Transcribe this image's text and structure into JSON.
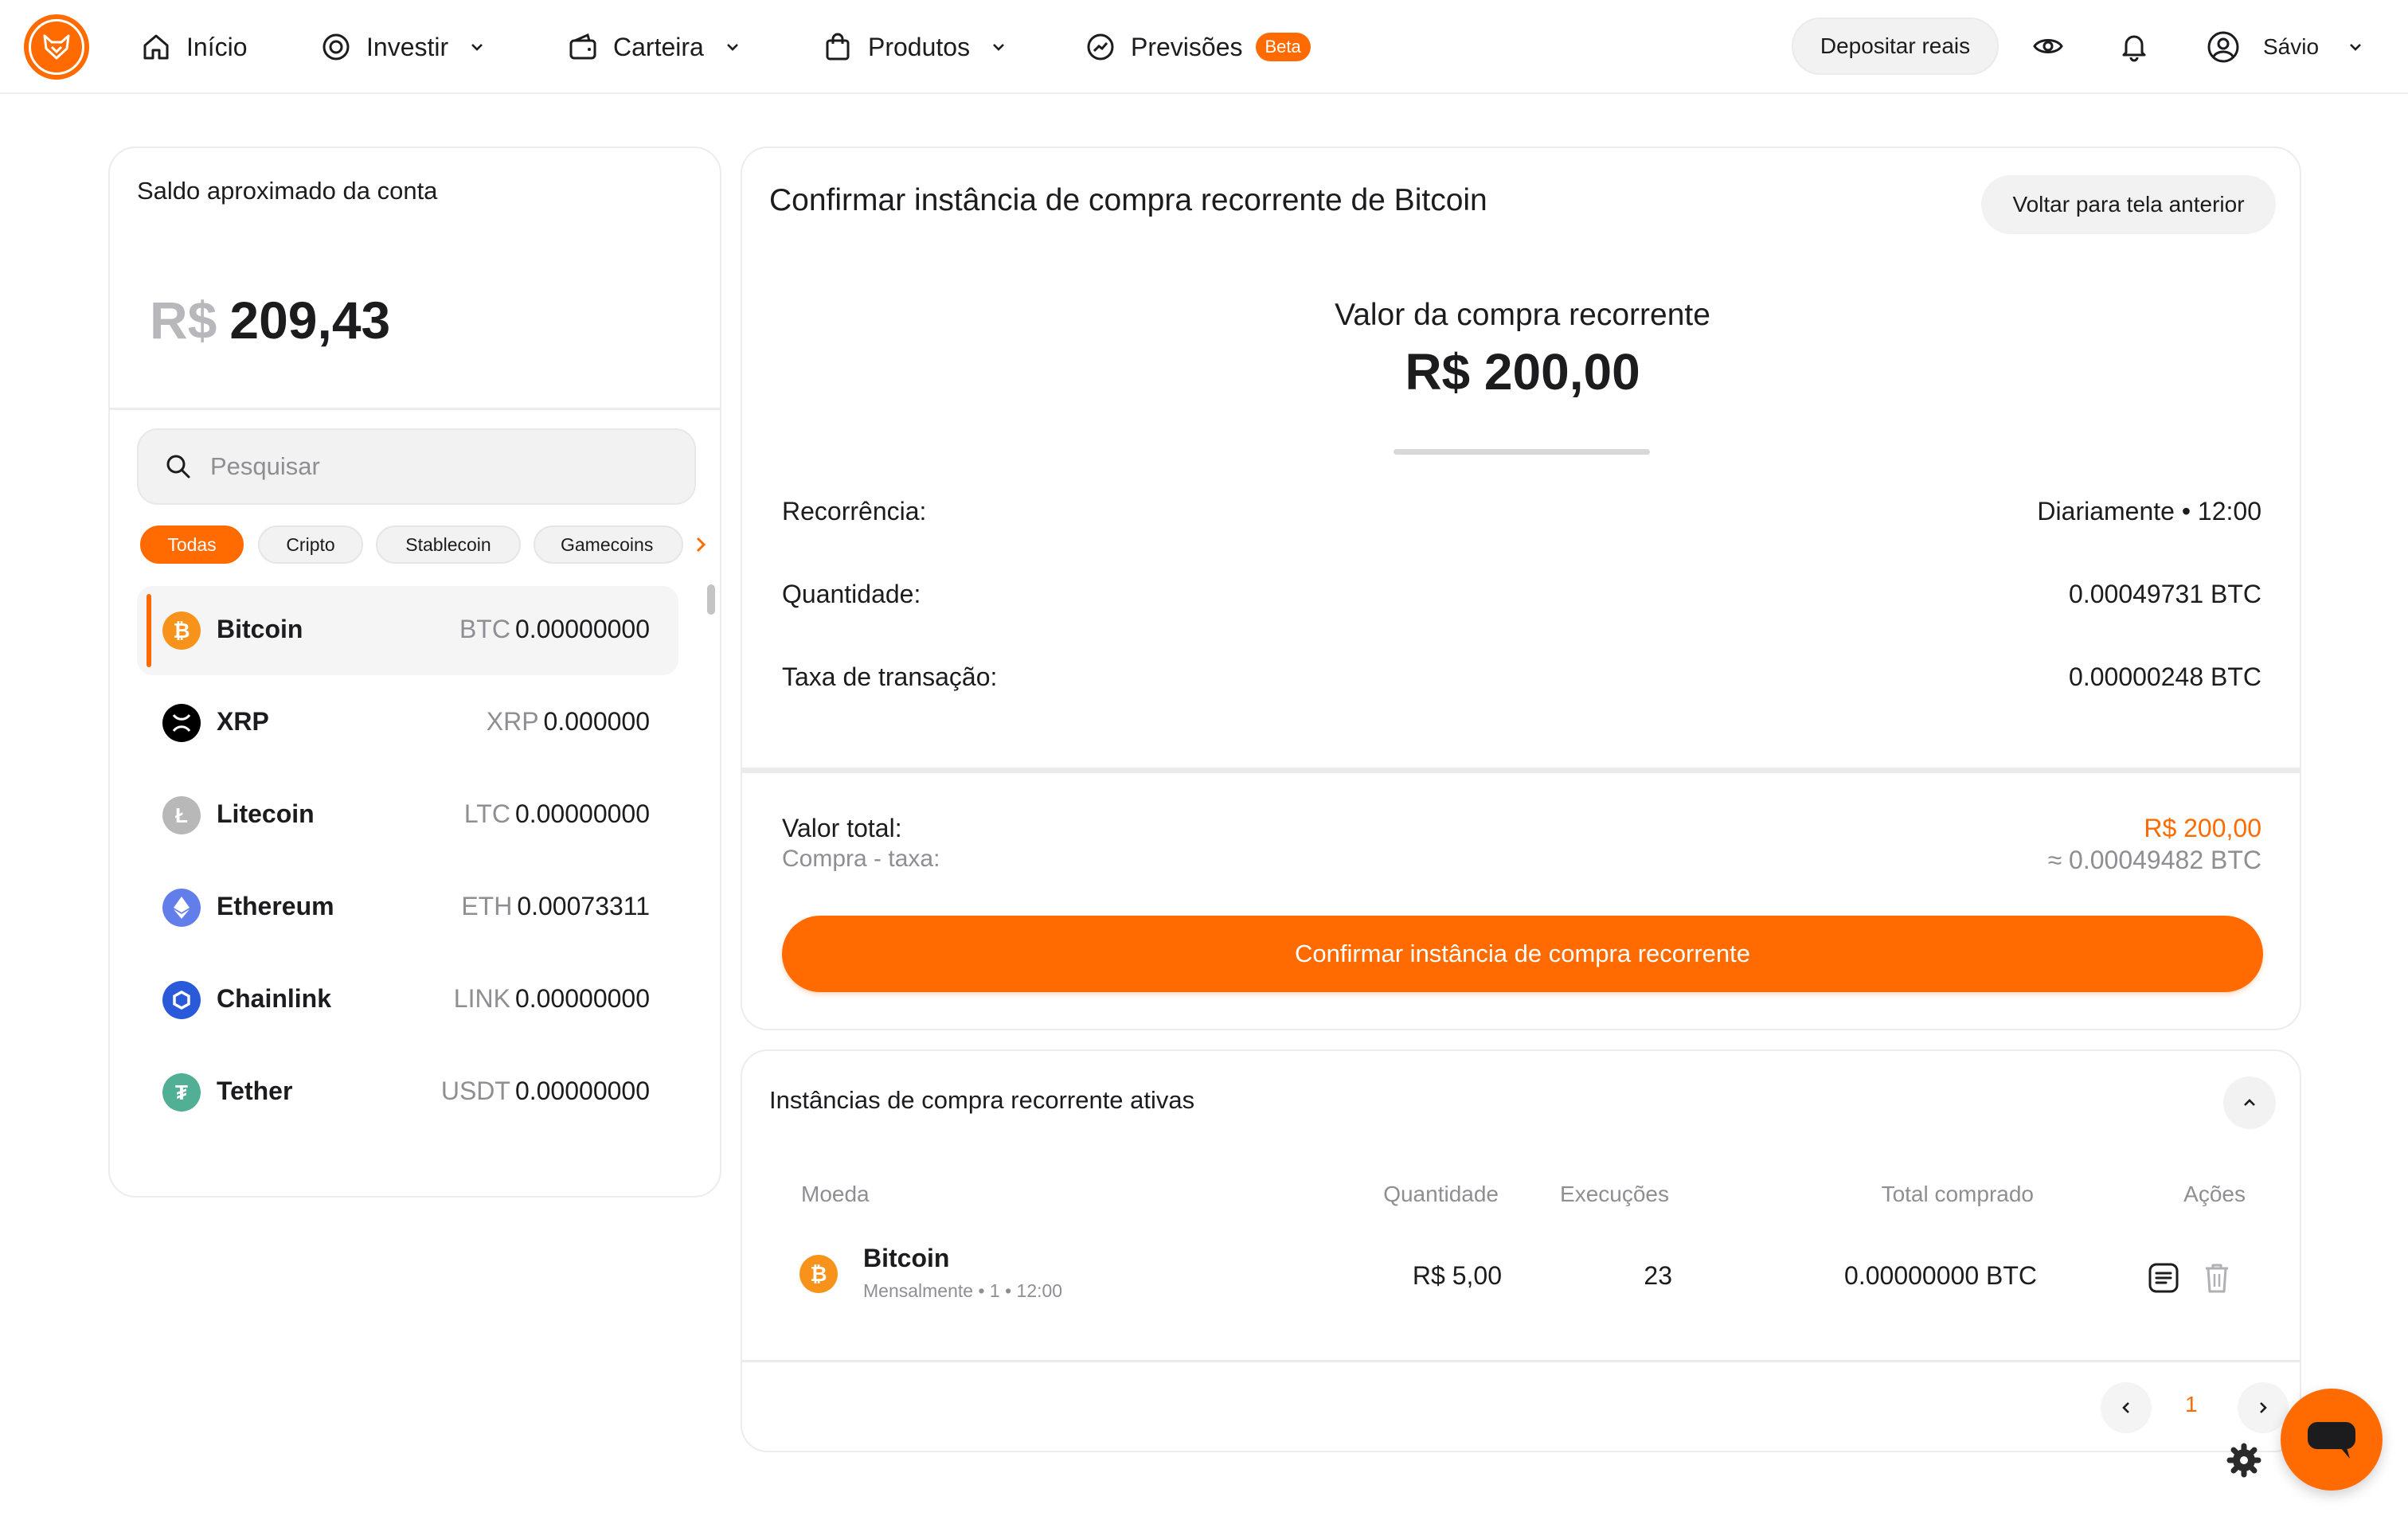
{
  "nav": {
    "items": [
      {
        "label": "Início",
        "icon": "home-icon"
      },
      {
        "label": "Investir",
        "icon": "target-icon",
        "dropdown": true
      },
      {
        "label": "Carteira",
        "icon": "wallet-icon",
        "dropdown": true
      },
      {
        "label": "Produtos",
        "icon": "shopping-bag-icon",
        "dropdown": true
      },
      {
        "label": "Previsões",
        "icon": "trend-icon",
        "badge": "Beta"
      }
    ],
    "deposit_label": "Depositar reais",
    "user_name": "Sávio"
  },
  "account": {
    "title": "Saldo aproximado da conta",
    "currency": "R$",
    "balance": "209,43",
    "search_placeholder": "Pesquisar",
    "filters": [
      "Todas",
      "Cripto",
      "Stablecoin",
      "Gamecoins"
    ],
    "active_filter": "Todas",
    "assets": [
      {
        "name": "Bitcoin",
        "symbol": "BTC",
        "amount": "0.00000000",
        "color": "#f7931a",
        "selected": true
      },
      {
        "name": "XRP",
        "symbol": "XRP",
        "amount": "0.000000",
        "color": "#000000"
      },
      {
        "name": "Litecoin",
        "symbol": "LTC",
        "amount": "0.00000000",
        "color": "#b8b8b8"
      },
      {
        "name": "Ethereum",
        "symbol": "ETH",
        "amount": "0.00073311",
        "color": "#627eea"
      },
      {
        "name": "Chainlink",
        "symbol": "LINK",
        "amount": "0.00000000",
        "color": "#2a5ada"
      },
      {
        "name": "Tether",
        "symbol": "USDT",
        "amount": "0.00000000",
        "color": "#50af95"
      }
    ]
  },
  "confirm": {
    "title": "Confirmar instância de compra recorrente de Bitcoin",
    "back_label": "Voltar para tela anterior",
    "value_label": "Valor da compra recorrente",
    "value_amount": "R$ 200,00",
    "details": [
      {
        "label": "Recorrência:",
        "value": "Diariamente • 12:00"
      },
      {
        "label": "Quantidade:",
        "value": "0.00049731 BTC"
      },
      {
        "label": "Taxa de transação:",
        "value": "0.00000248 BTC"
      }
    ],
    "total_label": "Valor total:",
    "total_value": "R$ 200,00",
    "net_label": "Compra - taxa:",
    "net_value": "≈ 0.00049482 BTC",
    "confirm_label": "Confirmar instância de compra recorrente"
  },
  "instances": {
    "title": "Instâncias de compra recorrente ativas",
    "columns": [
      "Moeda",
      "Quantidade",
      "Execuções",
      "Total comprado",
      "Ações"
    ],
    "rows": [
      {
        "coin": "Bitcoin",
        "schedule": "Mensalmente • 1 • 12:00",
        "amount": "R$ 5,00",
        "executions": "23",
        "total": "0.00000000 BTC"
      }
    ],
    "page": "1"
  },
  "colors": {
    "accent": "#ff6b00",
    "muted": "#8e8e93",
    "border": "#ececec"
  }
}
